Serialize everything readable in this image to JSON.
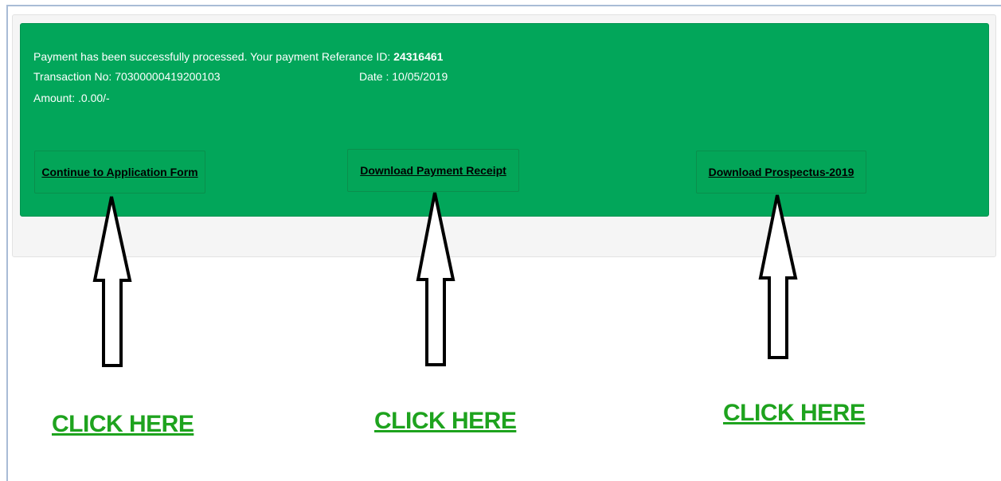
{
  "alert": {
    "message_prefix": "Payment has been successfully processed. Your payment Referance ID:",
    "reference_id": "24316461",
    "transaction": "Transaction No: 70300000419200103",
    "date": "Date : 10/05/2019",
    "amount": "Amount: .0.00/-"
  },
  "buttons": {
    "continue_label": "Continue to Application Form",
    "receipt_label": "Download  Payment  Receipt",
    "prospectus_label": "Download Prospectus-2019"
  },
  "annotations": {
    "click_here_1": "CLICK HERE",
    "click_here_2": "CLICK HERE",
    "click_here_3": "CLICK HERE"
  },
  "colors": {
    "alert_bg": "#02a65a",
    "click_text": "#1ea31e"
  }
}
